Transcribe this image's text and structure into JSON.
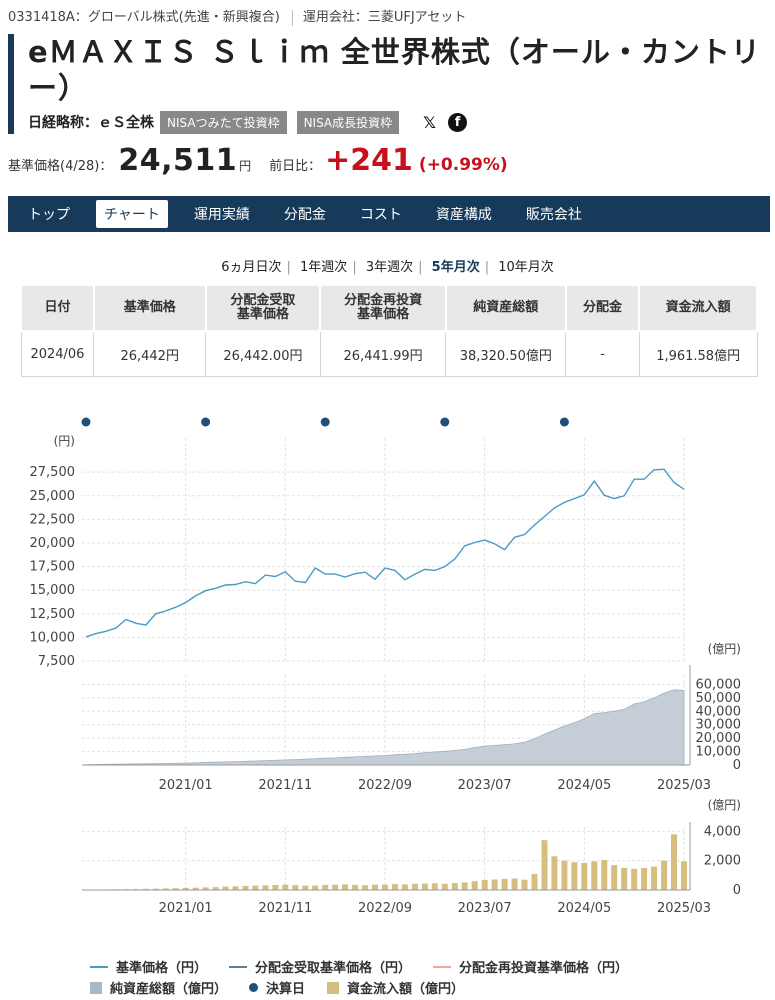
{
  "header": {
    "code": "0331418A",
    "category": "グローバル株式(先進・新興複合)",
    "manager": "運用会社：三菱UFJアセット",
    "title": "eＭＡＸＩＳ Ｓｌｉｍ 全世界株式（オール・カントリー）",
    "nikkei_short_label": "日経略称：ｅＳ全株",
    "tags": [
      "NISAつみたて投資枠",
      "NISA成長投資枠"
    ],
    "social_icons": [
      "x-icon",
      "facebook-icon"
    ]
  },
  "price": {
    "label": "基準価格(4/28)：",
    "value": "24,511",
    "unit": "円",
    "change_label": "前日比：",
    "change": "+241",
    "change_pct": "(+0.99%)"
  },
  "tabs": [
    "トップ",
    "チャート",
    "運用実績",
    "分配金",
    "コスト",
    "資産構成",
    "販売会社"
  ],
  "active_tab": "チャート",
  "periods": [
    "6ヵ月日次",
    "1年週次",
    "3年週次",
    "5年月次",
    "10年月次"
  ],
  "active_period": "5年月次",
  "table": {
    "headers": [
      "日付",
      "基準価格",
      "分配金受取\n基準価格",
      "分配金再投資\n基準価格",
      "純資産総額",
      "分配金",
      "資金流入額"
    ],
    "row": [
      "2024/06",
      "26,442円",
      "26,442.00円",
      "26,441.99円",
      "38,320.50億円",
      "-",
      "1,961.58億円"
    ]
  },
  "chart_data": [
    {
      "type": "line",
      "ylabel": "(円)",
      "yticks": [
        7500,
        10000,
        12500,
        15000,
        17500,
        20000,
        22500,
        25000,
        27500
      ],
      "ylim": [
        7500,
        29000
      ],
      "xticks": [
        "2021/01",
        "2021/11",
        "2022/09",
        "2023/07",
        "2024/05",
        "2025/03"
      ],
      "grid": true,
      "series": [
        {
          "name": "基準価格（円）",
          "color": "#4a9ac4",
          "values": [
            10050,
            10400,
            10650,
            11000,
            11900,
            11500,
            11300,
            12500,
            12800,
            13200,
            13700,
            14400,
            14950,
            15200,
            15550,
            15600,
            15900,
            15700,
            16600,
            16450,
            16950,
            15950,
            15800,
            17350,
            16700,
            16700,
            16400,
            16750,
            16900,
            16150,
            17350,
            17100,
            16100,
            16700,
            17200,
            17100,
            17500,
            18300,
            19700,
            20050,
            20300,
            19900,
            19300,
            20600,
            20900,
            21900,
            22800,
            23700,
            24300,
            24700,
            25100,
            26550,
            25050,
            24700,
            25000,
            26750,
            26750,
            27750,
            27800,
            26400,
            25700
          ]
        }
      ],
      "settlement_markers_at": [
        "2020/07",
        "2021/07",
        "2022/07",
        "2023/07",
        "2024/07"
      ]
    },
    {
      "type": "area",
      "ylabel": "(億円)",
      "yticks": [
        0,
        10000,
        20000,
        30000,
        40000,
        50000,
        60000
      ],
      "ylim": [
        0,
        67000
      ],
      "series": [
        {
          "name": "純資産総額（億円）",
          "color": "#c5ced6",
          "values": [
            300,
            400,
            500,
            600,
            700,
            800,
            900,
            1000,
            1150,
            1300,
            1450,
            1650,
            1900,
            2100,
            2300,
            2500,
            2750,
            3000,
            3250,
            3500,
            3800,
            4000,
            4300,
            4700,
            5050,
            5300,
            5700,
            6000,
            6400,
            6800,
            7100,
            7600,
            8000,
            8500,
            9200,
            9700,
            10200,
            10800,
            11600,
            13000,
            14000,
            14500,
            15200,
            15700,
            17000,
            19500,
            23000,
            26000,
            29000,
            31500,
            34500,
            38300,
            39000,
            40000,
            41500,
            45500,
            47000,
            50000,
            53500,
            56000,
            55500
          ]
        }
      ]
    },
    {
      "type": "bar",
      "ylabel": "(億円)",
      "yticks": [
        0,
        2000,
        4000
      ],
      "ylim": [
        0,
        4300
      ],
      "series": [
        {
          "name": "資金流入額（億円）",
          "color": "#d6bd80",
          "values": [
            20,
            30,
            40,
            50,
            60,
            70,
            80,
            90,
            100,
            120,
            140,
            160,
            180,
            200,
            230,
            250,
            280,
            300,
            320,
            340,
            360,
            330,
            300,
            310,
            340,
            360,
            380,
            350,
            330,
            360,
            370,
            400,
            380,
            420,
            440,
            460,
            420,
            480,
            520,
            600,
            680,
            720,
            760,
            780,
            700,
            1100,
            3400,
            2300,
            2000,
            1900,
            1850,
            1960,
            2050,
            1700,
            1500,
            1450,
            1500,
            1600,
            2000,
            3800,
            1950
          ]
        }
      ]
    }
  ],
  "legend": [
    {
      "name": "基準価格（円）",
      "kind": "line",
      "color": "#4a9ac4"
    },
    {
      "name": "分配金受取基準価格（円）",
      "kind": "line",
      "color": "#5d7f94"
    },
    {
      "name": "分配金再投資基準価格（円）",
      "kind": "line",
      "color": "#f1a6a6"
    },
    {
      "name": "純資産総額（億円）",
      "kind": "box",
      "color": "#a9b8c4"
    },
    {
      "name": "決算日",
      "kind": "dot",
      "color": "#1f4e79"
    },
    {
      "name": "資金流入額（億円）",
      "kind": "box",
      "color": "#d6bd80"
    }
  ]
}
